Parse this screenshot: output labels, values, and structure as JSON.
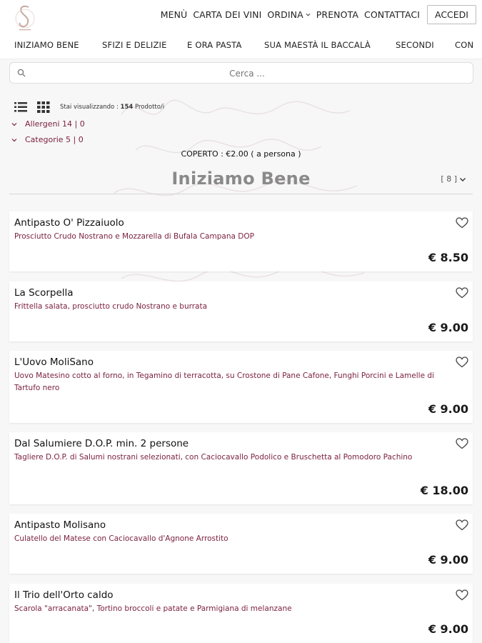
{
  "header": {
    "logo": "restaurant-logo",
    "nav": [
      {
        "label": "MENÙ"
      },
      {
        "label": "CARTA DEI VINI"
      },
      {
        "label": "ORDINA",
        "dropdown": true
      },
      {
        "label": "PRENOTA"
      },
      {
        "label": "CONTATTACI"
      }
    ],
    "login_label": "ACCEDI"
  },
  "categories": [
    "INIZIAMO BENE",
    "SFIZI E DELIZIE",
    "E ORA PASTA",
    "SUA MAESTÀ IL BACCALÀ",
    "SECONDI",
    "CON"
  ],
  "search": {
    "placeholder": "Cerca ..."
  },
  "view": {
    "prefix": "Stai visualizzando :",
    "count": "154",
    "suffix": "Prodotto/i"
  },
  "filters": {
    "allergens": "Allergeni 14 | 0",
    "categories": "Categorie 5 | 0"
  },
  "coperto": "COPERTO : €2.00 ( a persona )",
  "section": {
    "title": "Iniziamo Bene",
    "count": "[ 8 ]"
  },
  "products": [
    {
      "name": "Antipasto O' Pizzaiuolo",
      "description": "Prosciutto Crudo Nostrano e Mozzarella di Bufala Campana DOP",
      "price": "€ 8.50"
    },
    {
      "name": "La Scorpella",
      "description": "Frittella salata, prosciutto crudo Nostrano e burrata",
      "price": "€ 9.00"
    },
    {
      "name": "L'Uovo MoliSano",
      "description": "Uovo Matesino cotto al forno, in Tegamino di terracotta, su Crostone di Pane Cafone, Funghi Porcini e Lamelle di Tartufo nero",
      "price": "€ 9.00"
    },
    {
      "name": "Dal Salumiere D.O.P. min. 2 persone",
      "description": "Tagliere D.O.P. di Salumi nostrani selezionati, con Caciocavallo Podolico e Bruschetta al Pomodoro Pachino",
      "price": "€ 18.00"
    },
    {
      "name": "Antipasto Molisano",
      "description": "Culatello del Matese con Caciocavallo d'Agnone Arrostito",
      "price": "€ 9.00"
    },
    {
      "name": "Il Trio dell'Orto caldo",
      "description": "Scarola \"arracanata\", Tortino broccoli e patate e Parmigiana di melanzane",
      "price": "€ 9.00"
    }
  ],
  "colors": {
    "accent": "#7a1f3d",
    "section_title": "#8a8a8a",
    "background": "#f7f7f7"
  }
}
